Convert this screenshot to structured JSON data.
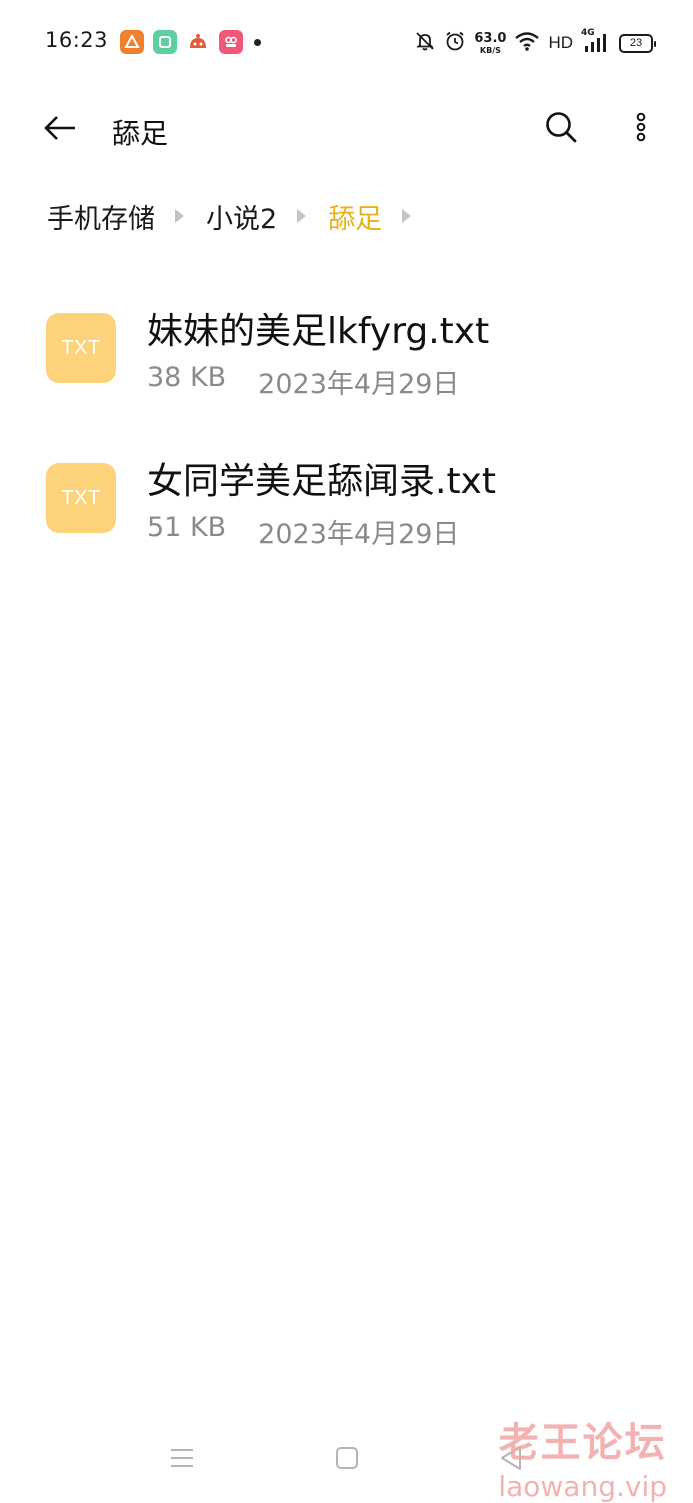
{
  "status_bar": {
    "time": "16:23",
    "net_speed_value": "63.0",
    "net_speed_unit": "KB/S",
    "hd_label": "HD",
    "signal_label": "4G",
    "battery_level": "23"
  },
  "header": {
    "title": "舔足"
  },
  "breadcrumb": [
    {
      "label": "手机存储"
    },
    {
      "label": "小说2"
    },
    {
      "label": "舔足"
    }
  ],
  "files": [
    {
      "icon_label": "TXT",
      "name": "妹妹的美足lkfyrg.txt",
      "size": "38 KB",
      "date": "2023年4月29日"
    },
    {
      "icon_label": "TXT",
      "name": "女同学美足舔闻录.txt",
      "size": "51 KB",
      "date": "2023年4月29日"
    }
  ],
  "watermark": {
    "title": "老王论坛",
    "domain": "laowang.vip"
  },
  "colors": {
    "accent": "#e8b11a",
    "txt_icon_bg": "#fcd27a",
    "meta_text": "#8a8a8a"
  }
}
